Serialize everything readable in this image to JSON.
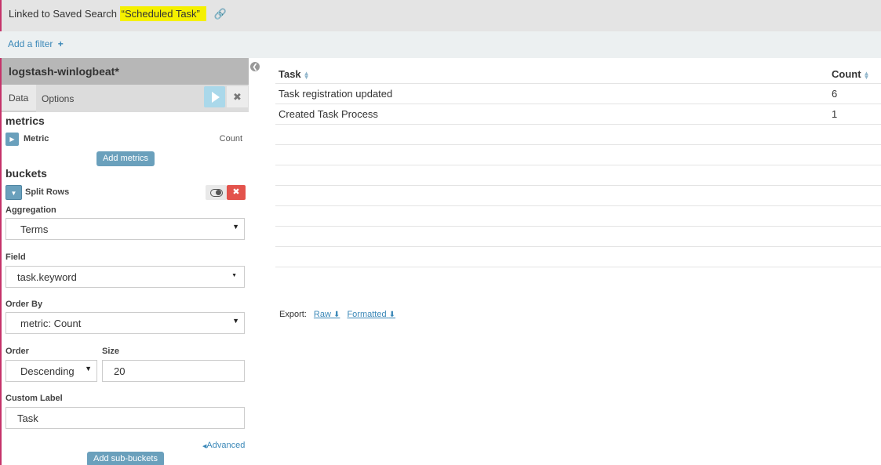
{
  "topbar": {
    "linked_prefix": "Linked to Saved Search",
    "saved_search_name": "“Scheduled Task”",
    "link_icon": "unlink-icon"
  },
  "filterbar": {
    "add_filter_label": "Add a filter",
    "add_icon": "plus-icon"
  },
  "sidebar": {
    "index_pattern": "logstash-winlogbeat*",
    "tabs": [
      {
        "label": "Data",
        "active": true
      },
      {
        "label": "Options",
        "active": false
      }
    ],
    "metrics_title": "metrics",
    "metric": {
      "label": "Metric",
      "value": "Count"
    },
    "add_metrics_label": "Add metrics",
    "buckets_title": "buckets",
    "split_rows_label": "Split Rows",
    "aggregation": {
      "label": "Aggregation",
      "value": "Terms"
    },
    "field": {
      "label": "Field",
      "value": "task.keyword"
    },
    "order_by": {
      "label": "Order By",
      "value": "metric: Count"
    },
    "order": {
      "label": "Order",
      "value": "Descending"
    },
    "size": {
      "label": "Size",
      "value": "20"
    },
    "custom_label": {
      "label": "Custom Label",
      "value": "Task"
    },
    "advanced_label": "Advanced",
    "add_sub_buckets_label": "Add sub-buckets"
  },
  "table": {
    "columns": [
      "Task",
      "Count"
    ],
    "rows": [
      {
        "task": "Task registration updated",
        "count": "6"
      },
      {
        "task": "Created Task Process",
        "count": "1"
      }
    ]
  },
  "export": {
    "label": "Export:",
    "raw": "Raw",
    "formatted": "Formatted"
  },
  "colors": {
    "accent": "#6aa0bc",
    "danger": "#e3534c",
    "highlight": "#f5f000",
    "link": "#3b88b8"
  }
}
